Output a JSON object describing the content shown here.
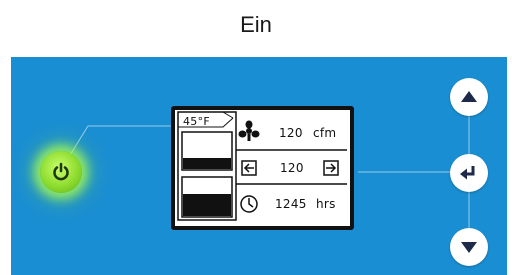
{
  "header": {
    "title": "Ein"
  },
  "colors": {
    "panel": "#1a8ed2",
    "power_glow": "#8edc2f",
    "lcd_border": "#111111"
  },
  "controls": {
    "power": {
      "icon": "power-icon"
    },
    "up": {
      "icon": "arrow-up-icon"
    },
    "enter": {
      "icon": "enter-icon"
    },
    "down": {
      "icon": "arrow-down-icon"
    }
  },
  "display": {
    "temperature": "45°F",
    "airflow": {
      "value": "120",
      "unit": "cfm",
      "icon": "fan-icon"
    },
    "setting": {
      "value": "120",
      "decrease_icon": "decrease-arrow-icon",
      "increase_icon": "increase-arrow-icon"
    },
    "hours": {
      "value": "1245",
      "unit": "hrs",
      "icon": "clock-icon"
    }
  }
}
